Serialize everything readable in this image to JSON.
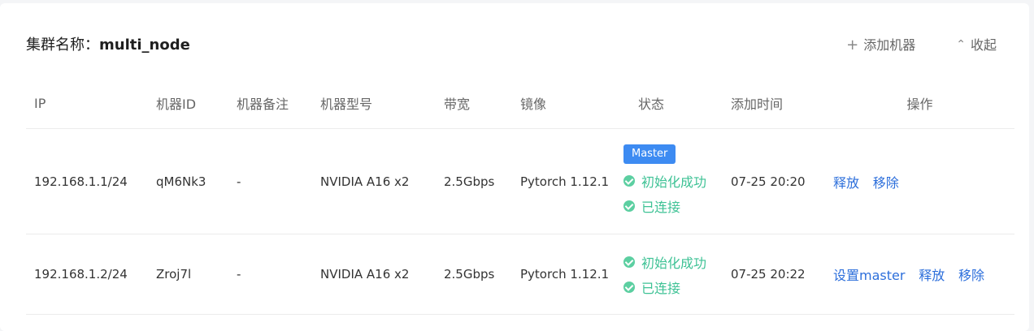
{
  "header": {
    "cluster_label": "集群名称：",
    "cluster_name": "multi_node",
    "add_button": "添加机器",
    "add_icon": "plus-icon",
    "collapse_button": "收起",
    "collapse_icon": "chevron-up-icon"
  },
  "table": {
    "columns": [
      "IP",
      "机器ID",
      "机器备注",
      "机器型号",
      "带宽",
      "镜像",
      "状态",
      "添加时间",
      "操作"
    ],
    "rows": [
      {
        "ip": "192.168.1.1/24",
        "machine_id": "qM6Nk3",
        "note": "-",
        "model": "NVIDIA A16 x2",
        "bandwidth": "2.5Gbps",
        "image": "Pytorch 1.12.1",
        "badge": "Master",
        "status_init": "初始化成功",
        "status_conn": "已连接",
        "added_time": "07-25 20:20",
        "actions": [
          "释放",
          "移除"
        ]
      },
      {
        "ip": "192.168.1.2/24",
        "machine_id": "Zroj7l",
        "note": "-",
        "model": "NVIDIA A16 x2",
        "bandwidth": "2.5Gbps",
        "image": "Pytorch 1.12.1",
        "status_init": "初始化成功",
        "status_conn": "已连接",
        "added_time": "07-25 20:22",
        "actions": [
          "设置master",
          "释放",
          "移除"
        ]
      }
    ]
  },
  "colors": {
    "accent": "#2d6fdb",
    "badge": "#3d8bf2",
    "success": "#3ec295"
  }
}
